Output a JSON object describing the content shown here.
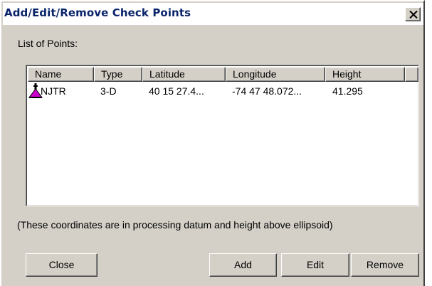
{
  "window": {
    "title": "Add/Edit/Remove Check Points",
    "close_glyph": "×"
  },
  "list_label": "List of Points:",
  "columns": [
    "Name",
    "Type",
    "Latitude",
    "Longitude",
    "Height"
  ],
  "rows": [
    {
      "icon": "check-point-triangle-icon",
      "name": "NJTR",
      "type": "3-D",
      "latitude": "40 15 27.4...",
      "longitude": "-74 47 48.072...",
      "height": "41.295"
    }
  ],
  "note": "(These coordinates are in processing datum and height above ellipsoid)",
  "buttons": {
    "close": "Close",
    "add": "Add",
    "edit": "Edit",
    "remove": "Remove"
  },
  "colors": {
    "title_text": "#0a246a",
    "dialog_face": "#d4d0c8",
    "icon_triangle": "#cc00cc"
  }
}
